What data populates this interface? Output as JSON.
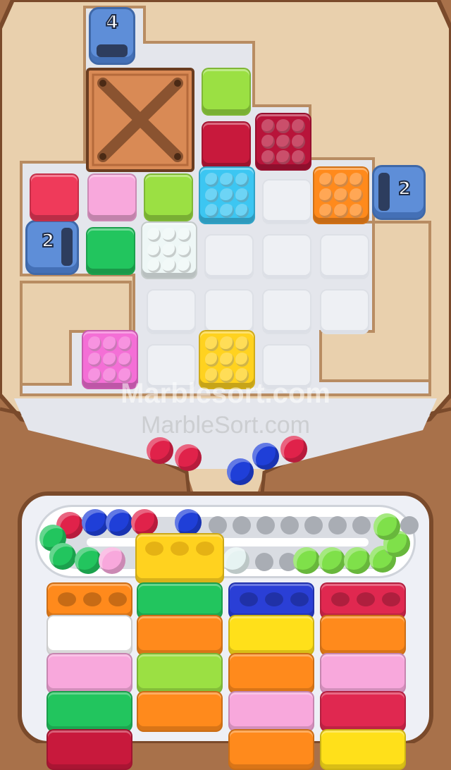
{
  "tunnels": [
    {
      "id": "top",
      "count": "4",
      "color": "#5e8ed8"
    },
    {
      "id": "right",
      "count": "2",
      "color": "#5e8ed8"
    },
    {
      "id": "left",
      "count": "2",
      "color": "#5e8ed8"
    }
  ],
  "grid_blocks": [
    {
      "name": "lime-block",
      "color": "#9be043",
      "studded": false
    },
    {
      "name": "crimson-block",
      "color": "#c8193c",
      "studded": false
    },
    {
      "name": "crimson-studded-block",
      "color": "#b8143a",
      "studded": true
    },
    {
      "name": "red-block",
      "color": "#ef3a5a",
      "studded": false
    },
    {
      "name": "pink-block",
      "color": "#f8a8dc",
      "studded": false
    },
    {
      "name": "lime-block-2",
      "color": "#9be043",
      "studded": false
    },
    {
      "name": "cyan-studded-block",
      "color": "#3cc6f2",
      "studded": true
    },
    {
      "name": "orange-studded-block",
      "color": "#ff8a1c",
      "studded": true
    },
    {
      "name": "green-block",
      "color": "#22c55e",
      "studded": false
    },
    {
      "name": "white-studded-block",
      "color": "#eef7f6",
      "studded": true
    },
    {
      "name": "pink-studded-block",
      "color": "#f46fd6",
      "studded": true
    },
    {
      "name": "yellow-studded-block",
      "color": "#ffd21f",
      "studded": true
    }
  ],
  "watermarks": [
    "Marblesort.com",
    "MarbleSort.com"
  ],
  "falling_marbles": [
    "#e0224a",
    "#e0224a",
    "#1f3fd8",
    "#1f3fd8",
    "#e0224a"
  ],
  "conveyor": {
    "track_color": "#ffffff",
    "center_block_color": "#ffd21f"
  },
  "columns": [
    {
      "top": "#ff8a1c",
      "stack": [
        "#ffffff",
        "#f8a8dc",
        "#22c55e",
        "#c8193c"
      ]
    },
    {
      "top": "#22c55e",
      "stack": [
        "#ff8a1c",
        "#9be043",
        "#ff8a1c"
      ]
    },
    {
      "top": "#2a3fd6",
      "stack": [
        "#ffe01a",
        "#ff8a1c",
        "#f8a8dc",
        "#ff8a1c"
      ]
    },
    {
      "top": "#e02850",
      "stack": [
        "#ff8a1c",
        "#f8a8dc",
        "#e02850",
        "#ffe01a"
      ]
    }
  ]
}
